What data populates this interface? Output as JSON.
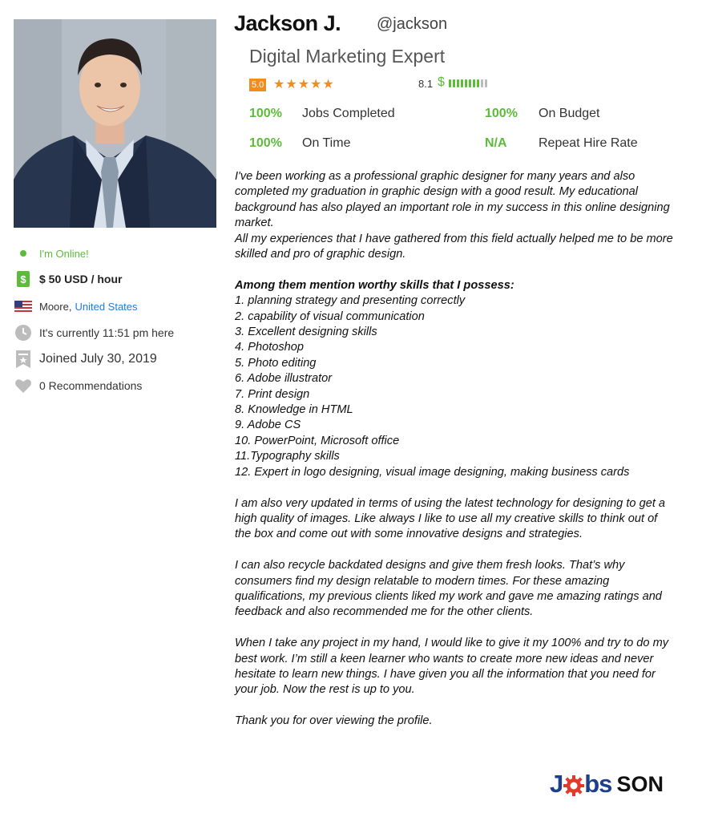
{
  "profile": {
    "name": "Jackson J.",
    "handle": "@jackson",
    "headline": "Digital Marketing Expert"
  },
  "rating": {
    "value": "5.0",
    "stars": "★★★★★",
    "score": "8.1",
    "dollar": "$",
    "bars_filled": 8,
    "bars_total": 10
  },
  "stats": [
    {
      "pct": "100%",
      "label": "Jobs Completed"
    },
    {
      "pct": "100%",
      "label": "On Budget"
    },
    {
      "pct": "100%",
      "label": "On Time"
    },
    {
      "pct": "N/A",
      "label": "Repeat Hire Rate"
    }
  ],
  "sidebar": {
    "online": "I'm Online!",
    "rate": "$ 50 USD / hour",
    "location_city": "Moore,",
    "location_country": "United States",
    "local_time": "It's currently 11:51 pm here",
    "joined": "Joined July 30, 2019",
    "recommendations": "0 Recommendations"
  },
  "bio": {
    "intro": "I've been working as a professional graphic designer for many years and also completed my graduation in graphic design with a good result. My educational background has also played an important role in my success in this online designing market.",
    "intro2": "All my experiences that I have gathered from this field actually helped me to be more skilled and pro of graphic design.",
    "skills_heading": "Among them mention worthy skills that I possess:",
    "skills": [
      "1. planning strategy and presenting correctly",
      "2. capability of visual communication",
      "3. Excellent designing skills",
      "4. Photoshop",
      "5. Photo editing",
      "6. Adobe illustrator",
      "7. Print design",
      "8. Knowledge in HTML",
      "9. Adobe CS",
      "10. PowerPoint, Microsoft office",
      "11.Typography skills",
      "12. Expert in logo designing, visual image designing, making business cards"
    ],
    "para_tech": "I am also very updated in terms of using the latest technology for designing to get a high quality of images. Like always I like to use all my creative skills to think out of the box and come out with some innovative designs and strategies.",
    "para_recycle": "I can also recycle backdated designs and give them fresh looks. That’s why consumers find my design relatable to modern times. For these amazing qualifications, my previous clients liked my work and gave me amazing ratings and feedback and also recommended me for the other clients.",
    "para_project": "When I take any project in my hand, I would like to give it my 100% and try to do my best work. I’m still a keen learner who wants to create more new ideas and never hesitate to learn new things. I have given you all the information that you need for your job. Now the rest is up to you.",
    "thanks": "Thank you for over viewing the profile."
  },
  "logo": {
    "part1": "J",
    "part2": "bs",
    "part3": "SON"
  },
  "colors": {
    "accent_green": "#5dbb3a",
    "star_orange": "#f28c1e",
    "link_blue": "#1f7bd8",
    "logo_blue": "#1e3f8c",
    "logo_red": "#e03a2c"
  }
}
